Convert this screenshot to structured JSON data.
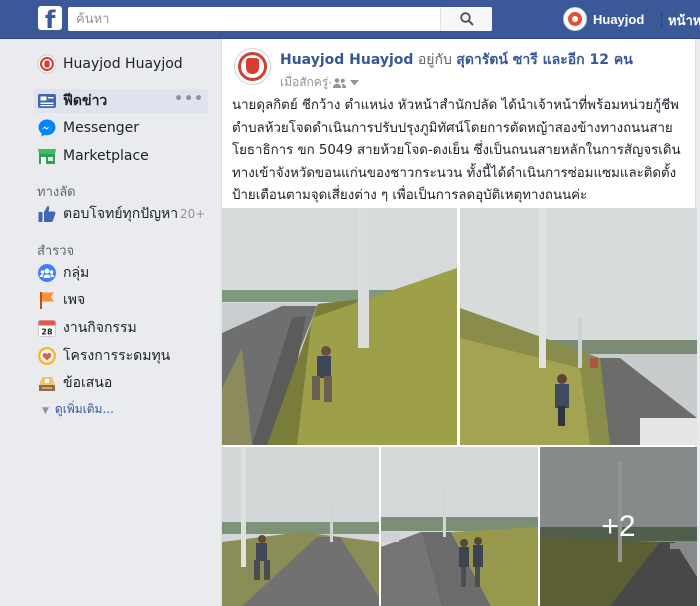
{
  "topbar": {
    "logo": "f",
    "search_placeholder": "ค้นหา",
    "profile_name": "Huayjod",
    "home_label": "หน้าห"
  },
  "sidebar": {
    "profile_label": "Huayjod Huayjod",
    "news_feed": "ฟีดข่าว",
    "more": "•••",
    "messenger": "Messenger",
    "marketplace": "Marketplace",
    "shortcuts_title": "ทางลัด",
    "shortcut_item": "ตอบโจทย์ทุกปัญหา",
    "shortcut_count": "20+",
    "explore_title": "สำรวจ",
    "explore": [
      {
        "label": "กลุ่ม",
        "icon": "groups-icon"
      },
      {
        "label": "เพจ",
        "icon": "pages-flag-icon"
      },
      {
        "label": "งานกิจกรรม",
        "icon": "events-calendar-icon",
        "calendar_day": "28"
      },
      {
        "label": "โครงการระดมทุน",
        "icon": "fundraiser-icon"
      },
      {
        "label": "ข้อเสนอ",
        "icon": "offers-icon"
      }
    ],
    "see_more": "ดูเพิ่มเติม..."
  },
  "post": {
    "author": "Huayjod Huayjod",
    "with_text": " อยู่กับ ",
    "tagged": "สุดารัตน์ ซารี และอีก 12 คน",
    "time": "เมื่อสักครู่",
    "separator": " · ",
    "text": "นายดุลกิตย์ ชีกว้าง ตำแหน่ง หัวหน้าสำนักปลัด ได้นำเจ้าหน้าที่พร้อมหน่วยกู้ชีพตำบลห้วยโจดดำเนินการปรับปรุงภูมิทัศน์โดยการตัดหญ้าสองข้างทางถนนสายโยธาธิการ ขก 5049 สายห้วยโจด-ดงเย็น ซึ่งเป็นถนนสายหลักในการสัญจรเดินทางเข้าจังหวัดขอนแก่นของชาวกระนวน ทั้งนี้ได้ดำเนินการซ่อมแซมและติดตั้งป้ายเตือนตามจุดเสี่ยงต่าง ๆ เพื่อเป็นการลดอุบัติเหตุทางถนนค่ะ",
    "more_photos": "+2"
  },
  "colors": {
    "brand": "#3b5998",
    "link": "#365899",
    "background": "#e9ebee"
  }
}
